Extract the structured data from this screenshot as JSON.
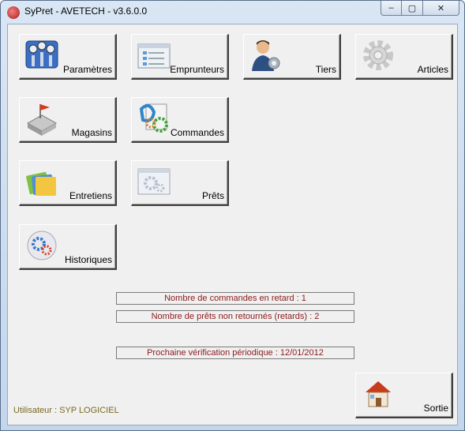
{
  "window": {
    "title": "SyPret - AVETECH - v3.6.0.0",
    "minimize": "–",
    "maximize": "▢",
    "close": "✕"
  },
  "tiles": {
    "parametres": "Paramètres",
    "emprunteurs": "Emprunteurs",
    "tiers": "Tiers",
    "articles": "Articles",
    "magasins": "Magasins",
    "commandes": "Commandes",
    "entretiens": "Entretiens",
    "prets": "Prêts",
    "historiques": "Historiques",
    "sortie": "Sortie"
  },
  "info": {
    "commandes_retard": "Nombre de commandes en retard : 1",
    "prets_non_retournes": "Nombre de prêts non retournés (retards) : 2",
    "verification": "Prochaine vérification périodique : 12/01/2012"
  },
  "status": {
    "user": "Utilisateur : SYP LOGICIEL"
  }
}
